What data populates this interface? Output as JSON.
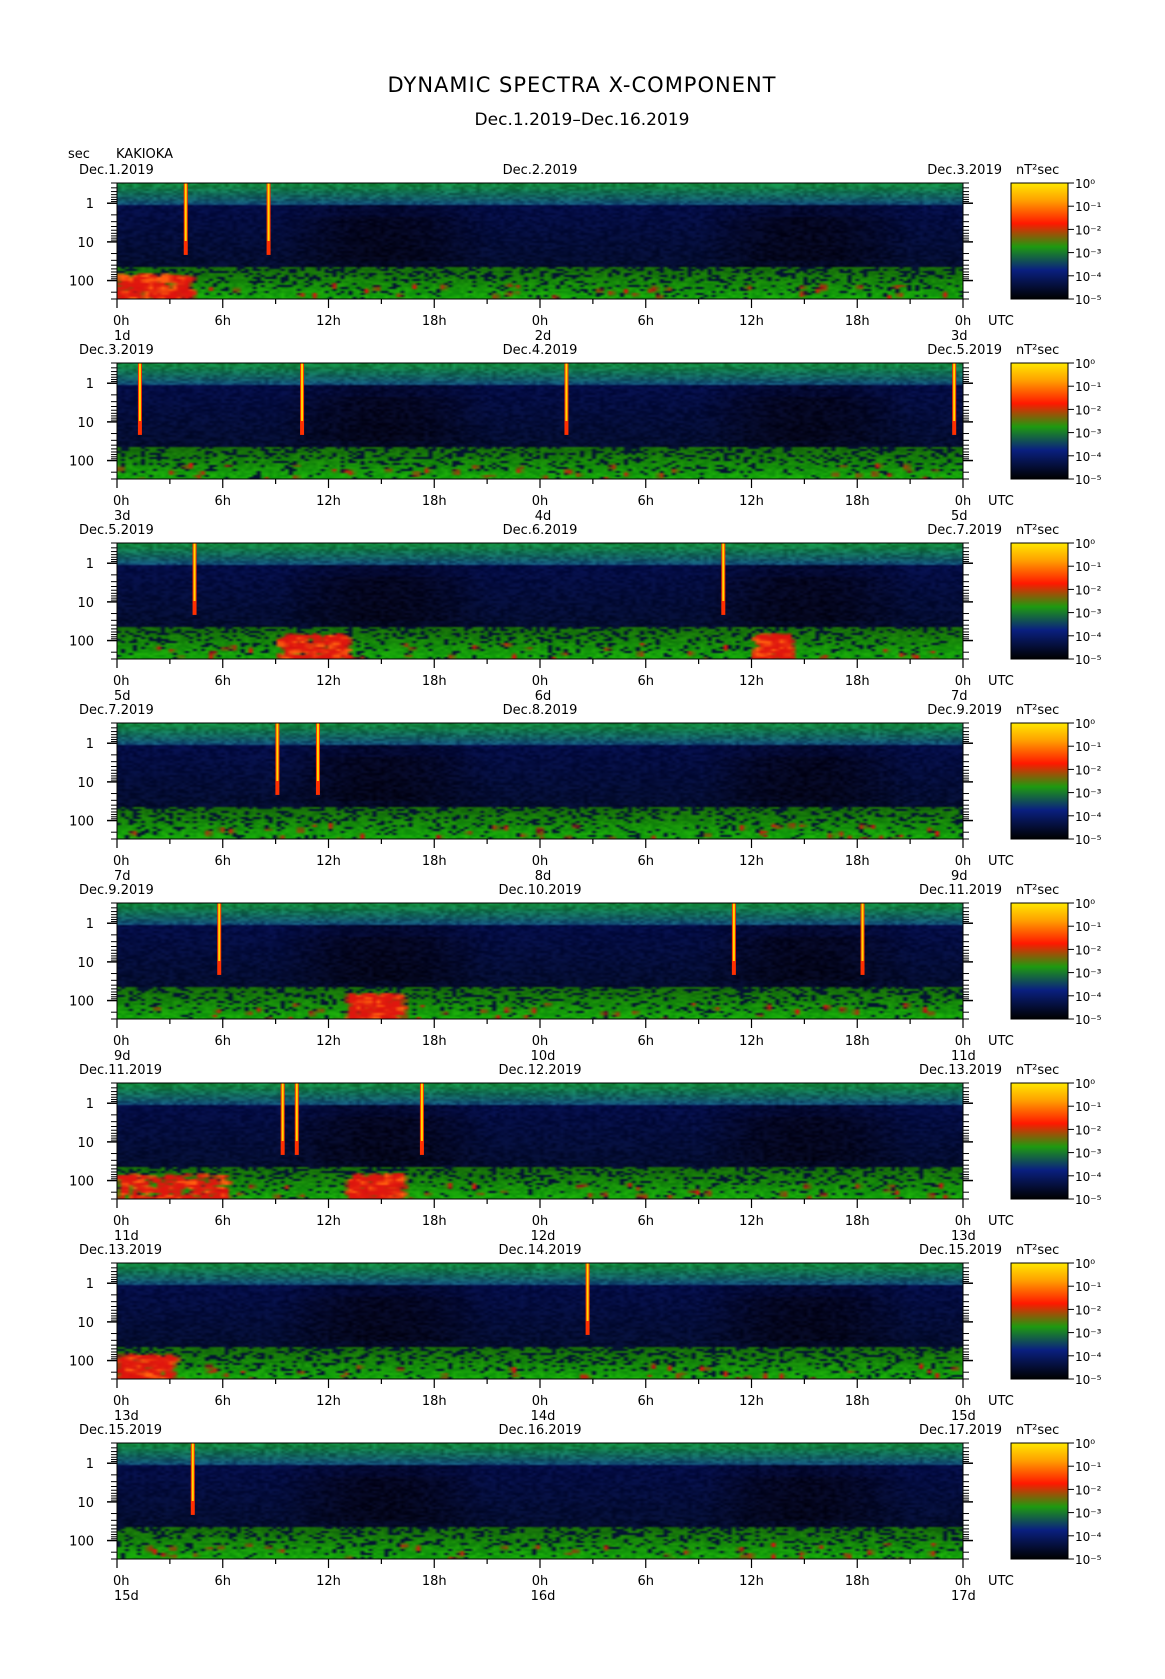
{
  "header": {
    "title": "DYNAMIC SPECTRA X-COMPONENT",
    "subtitle": "Dec.1.2019–Dec.16.2019",
    "ylabel": "sec",
    "station": "KAKIOKA",
    "utc_label": "UTC",
    "cbar_unit": "nT²sec"
  },
  "chart_data": {
    "type": "heatmap",
    "title": "DYNAMIC SPECTRA X-COMPONENT",
    "y_axis": {
      "label": "sec",
      "scale": "log",
      "range_sec": [
        0.3,
        300
      ],
      "ticks": [
        "1",
        "10",
        "100"
      ]
    },
    "x_tick_labels": [
      "0h",
      "6h",
      "12h",
      "18h",
      "0h",
      "6h",
      "12h",
      "18h",
      "0h"
    ],
    "colorbar": {
      "unit": "nT²sec",
      "ticks": [
        "10⁰",
        "10⁻¹",
        "10⁻²",
        "10⁻³",
        "10⁻⁴",
        "10⁻⁵"
      ],
      "colors": [
        "#FFE000",
        "#FF2000",
        "#1E9010",
        "#0A1E6E",
        "#000000"
      ]
    },
    "panels": [
      {
        "start_date": "Dec.1.2019",
        "mid_date": "Dec.2.2019",
        "end_date": "Dec.3.2019",
        "day_labels": [
          "1d",
          "2d",
          "3d"
        ],
        "spikes_hours": [
          3.9,
          8.6
        ],
        "red_activity": [
          [
            0,
            4,
            0.9
          ]
        ]
      },
      {
        "start_date": "Dec.3.2019",
        "mid_date": "Dec.4.2019",
        "end_date": "Dec.5.2019",
        "day_labels": [
          "3d",
          "4d",
          "5d"
        ],
        "spikes_hours": [
          1.3,
          10.5,
          25.5,
          47.5
        ],
        "red_activity": []
      },
      {
        "start_date": "Dec.5.2019",
        "mid_date": "Dec.6.2019",
        "end_date": "Dec.7.2019",
        "day_labels": [
          "5d",
          "6d",
          "7d"
        ],
        "spikes_hours": [
          4.4,
          34.4
        ],
        "red_activity": [
          [
            9,
            13,
            0.6
          ],
          [
            36,
            38,
            0.6
          ]
        ]
      },
      {
        "start_date": "Dec.7.2019",
        "mid_date": "Dec.8.2019",
        "end_date": "Dec.9.2019",
        "day_labels": [
          "7d",
          "8d",
          "9d"
        ],
        "spikes_hours": [
          9.1,
          11.4
        ],
        "red_activity": []
      },
      {
        "start_date": "Dec.9.2019",
        "mid_date": "Dec.10.2019",
        "end_date": "Dec.11.2019",
        "day_labels": [
          "9d",
          "10d",
          "11d"
        ],
        "spikes_hours": [
          5.8,
          35.0,
          42.3
        ],
        "red_activity": [
          [
            13,
            16,
            0.6
          ]
        ]
      },
      {
        "start_date": "Dec.11.2019",
        "mid_date": "Dec.12.2019",
        "end_date": "Dec.13.2019",
        "day_labels": [
          "11d",
          "12d",
          "13d"
        ],
        "spikes_hours": [
          9.4,
          10.2,
          17.3
        ],
        "red_activity": [
          [
            0,
            6,
            0.7
          ],
          [
            13,
            16,
            0.6
          ]
        ]
      },
      {
        "start_date": "Dec.13.2019",
        "mid_date": "Dec.14.2019",
        "end_date": "Dec.15.2019",
        "day_labels": [
          "13d",
          "14d",
          "15d"
        ],
        "spikes_hours": [
          26.7
        ],
        "red_activity": [
          [
            0,
            3,
            0.6
          ]
        ]
      },
      {
        "start_date": "Dec.15.2019",
        "mid_date": "Dec.16.2019",
        "end_date": "Dec.17.2019",
        "day_labels": [
          "15d",
          "16d",
          "17d"
        ],
        "spikes_hours": [
          4.3
        ],
        "red_activity": []
      }
    ]
  }
}
